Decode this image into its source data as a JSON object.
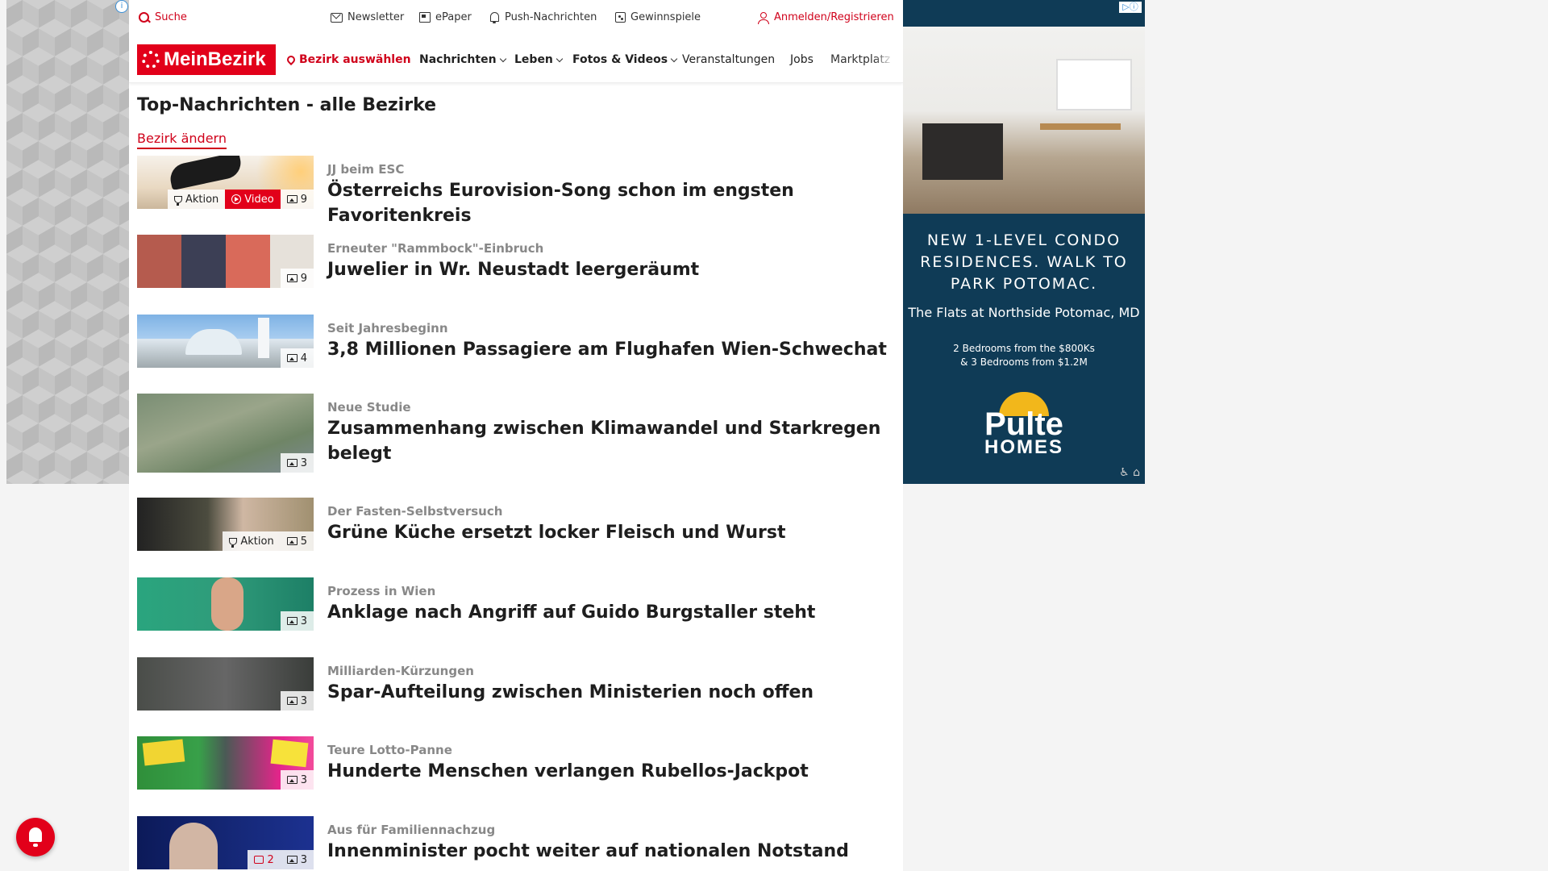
{
  "topbar": {
    "search": "Suche",
    "newsletter": "Newsletter",
    "epaper": "ePaper",
    "push": "Push-Nachrichten",
    "gewinnspiele": "Gewinnspiele",
    "login": "Anmelden/Registrieren"
  },
  "nav": {
    "logo": "MeinBezirk",
    "bezirk": "Bezirk auswählen",
    "nachrichten": "Nachrichten",
    "leben": "Leben",
    "fotos": "Fotos & Videos",
    "veranstaltungen": "Veranstaltungen",
    "jobs": "Jobs",
    "marktplatz": "Marktplatz"
  },
  "page": {
    "title": "Top-Nachrichten - alle Bezirke",
    "change_district": "Bezirk ändern"
  },
  "articles": [
    {
      "kicker": "JJ beim ESC",
      "headline": "Österreichs Eurovision-Song schon im engsten Favoritenkreis",
      "aktion": "Aktion",
      "video": "Video",
      "images": "9"
    },
    {
      "kicker": "Erneuter \"Rammbock\"-Einbruch",
      "headline": "Juwelier in Wr. Neustadt leergeräumt",
      "images": "9"
    },
    {
      "kicker": "Seit Jahresbeginn",
      "headline": "3,8 Millionen Passagiere am Flughafen Wien-Schwechat",
      "images": "4"
    },
    {
      "kicker": "Neue Studie",
      "headline": "Zusammenhang zwischen Klimawandel und Starkregen belegt",
      "images": "3"
    },
    {
      "kicker": "Der Fasten-Selbstversuch",
      "headline": "Grüne Küche ersetzt locker Fleisch und Wurst",
      "aktion": "Aktion",
      "images": "5"
    },
    {
      "kicker": "Prozess in Wien",
      "headline": "Anklage nach Angriff auf Guido Burgstaller steht",
      "images": "3"
    },
    {
      "kicker": "Milliarden-Kürzungen",
      "headline": "Spar-Aufteilung zwischen Ministerien noch offen",
      "images": "3"
    },
    {
      "kicker": "Teure Lotto-Panne",
      "headline": "Hunderte Menschen verlangen Rubellos-Jackpot",
      "images": "3"
    },
    {
      "kicker": "Aus für Familiennachzug",
      "headline": "Innenminister pocht weiter auf nationalen Notstand",
      "comments": "2",
      "images": "3"
    }
  ],
  "ad": {
    "headline": "NEW 1-LEVEL CONDO RESIDENCES. WALK TO PARK POTOMAC.",
    "sub": "The Flats at Northside Potomac, MD",
    "small1": "2 Bedrooms from the $800Ks",
    "small2": "& 3 Bedrooms from $1.2M",
    "brand1": "Pulte",
    "brand2": "HOMES"
  },
  "colors": {
    "accent": "#e2001a",
    "ad_bg": "#0f3b56",
    "roof": "#f2b71b"
  }
}
